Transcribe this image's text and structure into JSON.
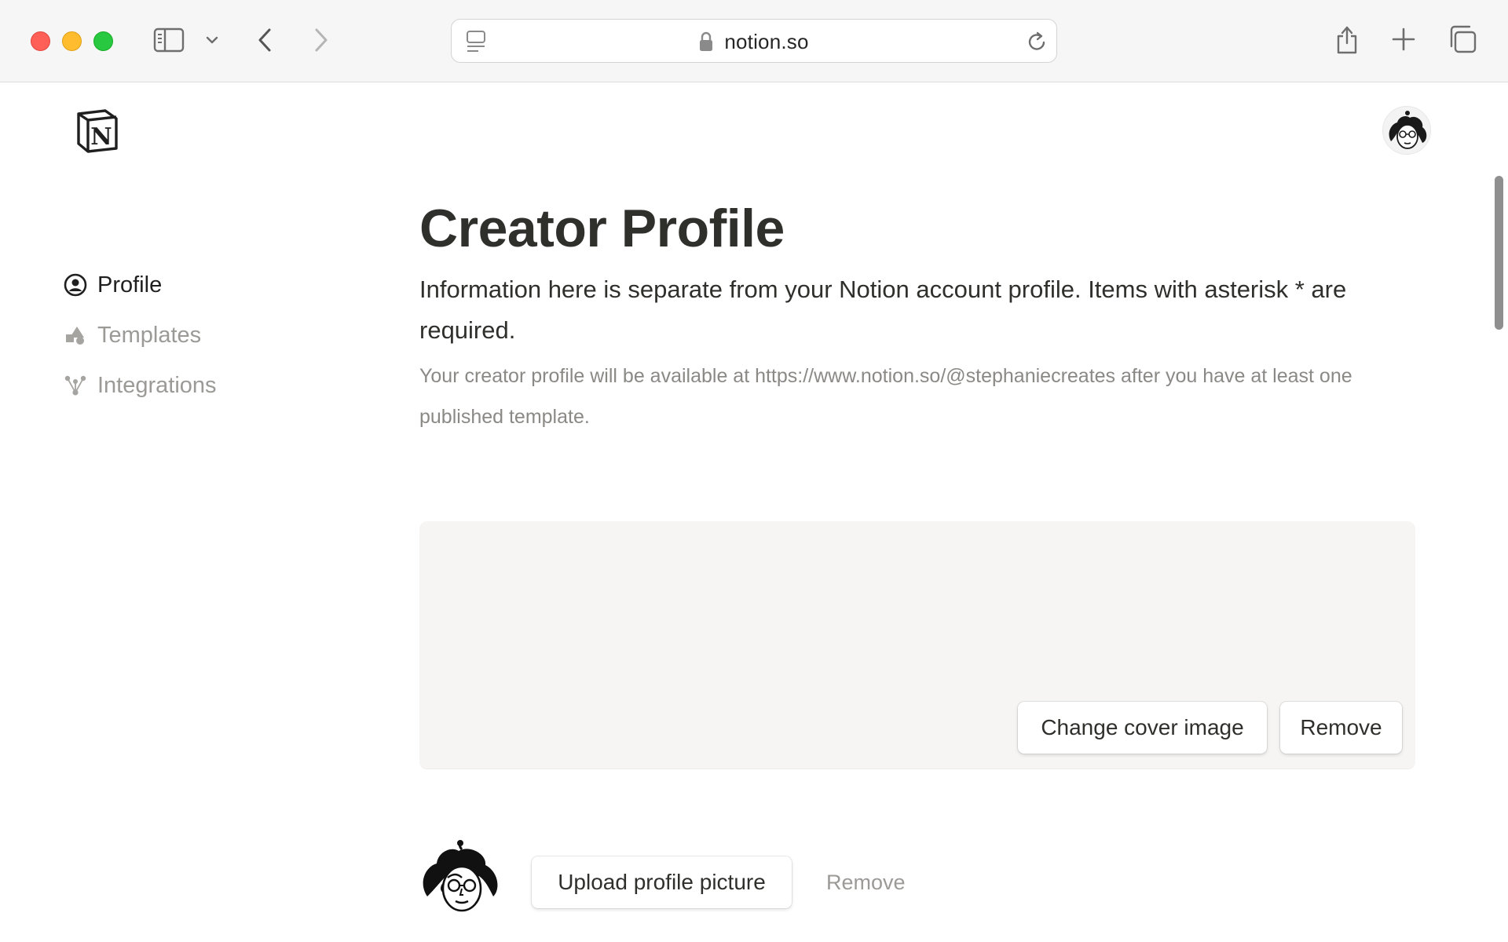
{
  "browser": {
    "url": "notion.so",
    "icons": {
      "sidebar": "sidebar-toggle-icon",
      "chevron": "chevron-down-icon",
      "back": "back-arrow-icon",
      "forward": "forward-arrow-icon",
      "share": "share-icon",
      "new_tab": "plus-icon",
      "tabs": "tab-overview-icon",
      "reader": "reader-icon",
      "lock": "lock-icon",
      "reload": "reload-icon"
    }
  },
  "nav": {
    "items": [
      {
        "label": "Profile",
        "icon": "user-circle-icon",
        "active": true
      },
      {
        "label": "Templates",
        "icon": "shapes-icon",
        "active": false
      },
      {
        "label": "Integrations",
        "icon": "network-icon",
        "active": false
      }
    ]
  },
  "main": {
    "title": "Creator Profile",
    "subtitle": "Information here is separate from your Notion account profile. Items with asterisk * are required.",
    "helper": "Your creator profile will be available at https://www.notion.so/@stephaniecreates after you have at least one published template."
  },
  "cover": {
    "change_label": "Change cover image",
    "remove_label": "Remove",
    "background": "#f7f5f3"
  },
  "profile_picture": {
    "upload_label": "Upload profile picture",
    "remove_label": "Remove"
  },
  "colors": {
    "accent_text": "#37352f",
    "muted_text": "#9b9a97",
    "traffic_red": "#fe5f57",
    "traffic_yellow": "#febc2e",
    "traffic_green": "#28c840"
  }
}
